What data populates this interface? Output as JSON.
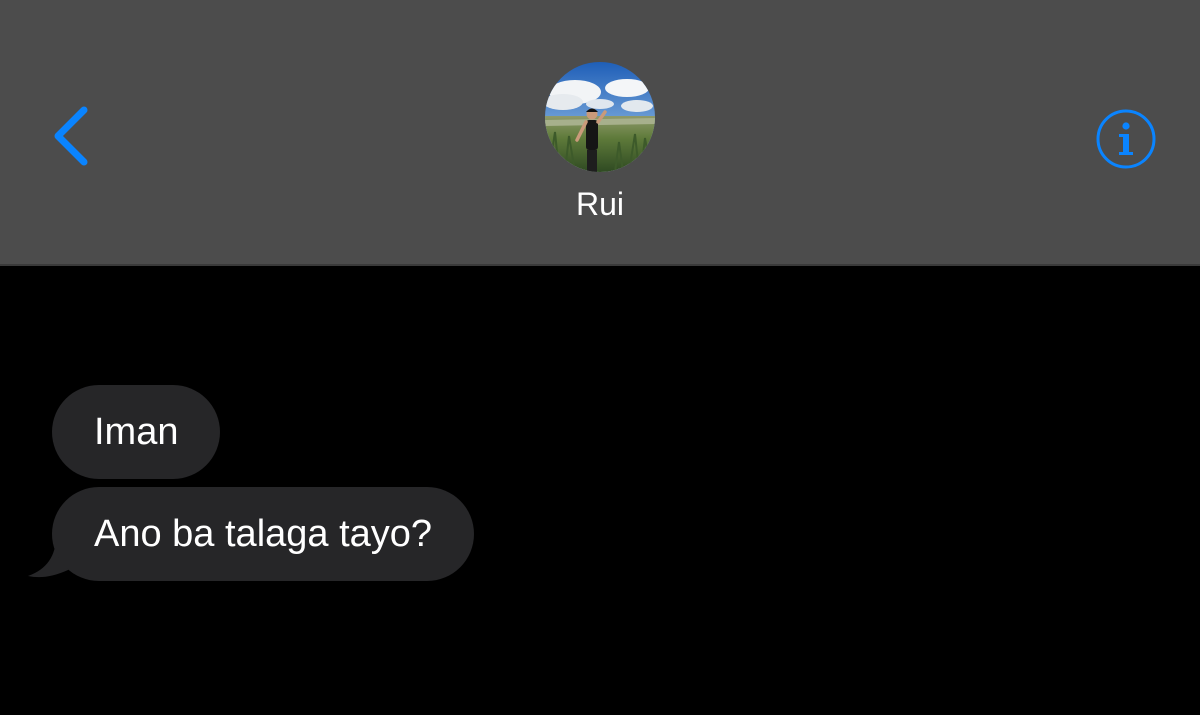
{
  "header": {
    "back_icon": "chevron-left-icon",
    "avatar_icon": "contact-photo",
    "contact_name": "Rui",
    "info_icon": "info-circle-icon"
  },
  "messages": [
    {
      "direction": "incoming",
      "text": "Iman"
    },
    {
      "direction": "incoming",
      "text": "Ano ba talaga tayo?"
    }
  ],
  "colors": {
    "accent": "#0a84ff",
    "header_bg": "#4c4c4c",
    "thread_bg": "#000000",
    "incoming_bubble": "#262628",
    "text": "#ffffff"
  }
}
